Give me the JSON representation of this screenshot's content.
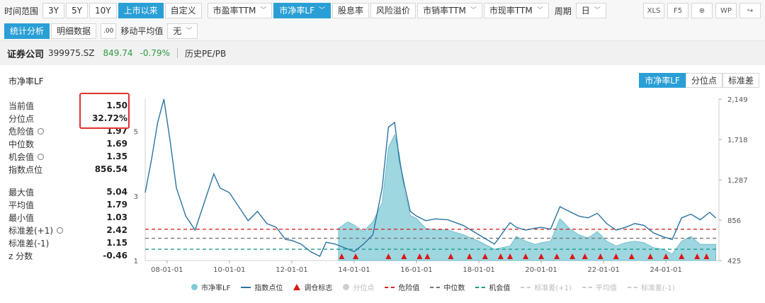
{
  "toolbar": {
    "range_label": "时间范围",
    "ranges": [
      {
        "label": "3Y",
        "active": false
      },
      {
        "label": "5Y",
        "active": false
      },
      {
        "label": "10Y",
        "active": false
      },
      {
        "label": "上市以来",
        "active": true
      },
      {
        "label": "自定义",
        "active": false
      }
    ],
    "metrics": [
      {
        "label": "市盈率TTM",
        "dropdown": true,
        "active": false
      },
      {
        "label": "市净率LF",
        "dropdown": true,
        "active": true
      },
      {
        "label": "股息率",
        "dropdown": false,
        "active": false
      },
      {
        "label": "风险溢价",
        "dropdown": false,
        "active": false
      },
      {
        "label": "市销率TTM",
        "dropdown": true,
        "active": false
      },
      {
        "label": "市现率TTM",
        "dropdown": true,
        "active": false
      }
    ],
    "period_label": "周期",
    "period_value": "日",
    "right_tools": [
      "XLS",
      "F5",
      "⊕",
      "WP",
      "↪"
    ],
    "view_tabs": [
      {
        "label": "统计分析",
        "active": true
      },
      {
        "label": "明细数据",
        "active": false
      }
    ],
    "decimal_icon": ".00",
    "ma_label": "移动平均值",
    "ma_value": "无"
  },
  "header": {
    "name": "证券公司",
    "code": "399975.SZ",
    "price": "849.74",
    "change": "-0.79%",
    "hist": "历史PE/PB"
  },
  "panel": {
    "title": "市净率LF",
    "tabs": [
      {
        "label": "市净率LF",
        "active": true
      },
      {
        "label": "分位点",
        "active": false
      },
      {
        "label": "标准差",
        "active": false
      }
    ]
  },
  "stats": {
    "group1": [
      {
        "name": "当前值",
        "value": "1.50",
        "gear": false
      },
      {
        "name": "分位点",
        "value": "32.72%",
        "gear": false
      },
      {
        "name": "危险值",
        "value": "1.97",
        "gear": true
      },
      {
        "name": "中位数",
        "value": "1.69",
        "gear": false
      },
      {
        "name": "机会值",
        "value": "1.35",
        "gear": true
      },
      {
        "name": "指数点位",
        "value": "856.54",
        "gear": false
      }
    ],
    "group2": [
      {
        "name": "最大值",
        "value": "5.04",
        "gear": false
      },
      {
        "name": "平均值",
        "value": "1.79",
        "gear": false
      },
      {
        "name": "最小值",
        "value": "1.03",
        "gear": false
      },
      {
        "name": "标准差(+1)",
        "value": "2.42",
        "gear": true
      },
      {
        "name": "标准差(-1)",
        "value": "1.15",
        "gear": false
      },
      {
        "name": "z 分数",
        "value": "-0.46",
        "gear": false
      }
    ]
  },
  "chart_data": {
    "type": "line",
    "x_ticks": [
      "08-01-01",
      "10-01-01",
      "12-01-01",
      "14-01-01",
      "16-01-01",
      "18-01-01",
      "20-01-01",
      "22-01-01",
      "24-01-01"
    ],
    "x_range": [
      2007.3,
      2025.7
    ],
    "y_left_ticks": [
      "5",
      "3",
      "1"
    ],
    "y_left_range": [
      1,
      6
    ],
    "y_right_ticks": [
      "2,149",
      "1,718",
      "1,287",
      "856",
      "425"
    ],
    "y_right_range": [
      425,
      2149
    ],
    "grid": false,
    "legend": [
      {
        "name": "市净率LF",
        "kind": "dot",
        "color": "#7ecad6",
        "muted": false
      },
      {
        "name": "指数点位",
        "kind": "line",
        "color": "#2b73a0",
        "muted": false
      },
      {
        "name": "调仓标志",
        "kind": "tri",
        "color": "#e01414",
        "muted": false
      },
      {
        "name": "分位点",
        "kind": "dot",
        "color": "#cfcfcf",
        "muted": true
      },
      {
        "name": "危险值",
        "kind": "dash",
        "color": "#d42a2a",
        "muted": false
      },
      {
        "name": "中位数",
        "kind": "dash",
        "color": "#777777",
        "muted": false
      },
      {
        "name": "机会值",
        "kind": "dash",
        "color": "#1e9c8a",
        "muted": false
      },
      {
        "name": "标准差(+1)",
        "kind": "dash",
        "color": "#cccccc",
        "muted": true
      },
      {
        "name": "平均值",
        "kind": "dash",
        "color": "#cccccc",
        "muted": true
      },
      {
        "name": "标准差(-1)",
        "kind": "dash",
        "color": "#cccccc",
        "muted": true
      }
    ],
    "levels": {
      "danger": 1.97,
      "median": 1.69,
      "opportunity": 1.35
    },
    "pb_series": {
      "x": [
        2013.5,
        2013.8,
        2014.0,
        2014.3,
        2014.6,
        2014.9,
        2015.1,
        2015.3,
        2015.45,
        2015.6,
        2015.8,
        2016.0,
        2016.3,
        2016.6,
        2017.0,
        2017.5,
        2018.0,
        2018.5,
        2019.0,
        2019.2,
        2019.5,
        2019.8,
        2020.0,
        2020.3,
        2020.6,
        2020.9,
        2021.2,
        2021.5,
        2021.8,
        2022.1,
        2022.4,
        2022.7,
        2023.0,
        2023.3,
        2023.6,
        2023.9,
        2024.2,
        2024.5,
        2024.8,
        2025.1,
        2025.4,
        2025.6
      ],
      "y": [
        2.0,
        2.2,
        2.1,
        1.9,
        2.2,
        2.8,
        4.5,
        4.9,
        4.3,
        3.2,
        2.4,
        2.3,
        2.0,
        1.95,
        1.95,
        1.8,
        1.6,
        1.35,
        1.45,
        1.75,
        1.6,
        1.5,
        1.55,
        1.6,
        2.3,
        2.0,
        1.8,
        1.7,
        1.9,
        1.6,
        1.45,
        1.55,
        1.6,
        1.55,
        1.4,
        1.35,
        1.2,
        1.6,
        1.75,
        1.5,
        1.5,
        1.5
      ]
    },
    "index_series": {
      "x": [
        2007.3,
        2007.5,
        2007.7,
        2007.9,
        2008.1,
        2008.3,
        2008.6,
        2008.9,
        2009.2,
        2009.5,
        2009.7,
        2010.0,
        2010.3,
        2010.6,
        2010.9,
        2011.2,
        2011.5,
        2011.8,
        2012.0,
        2012.3,
        2012.6,
        2012.9,
        2013.1,
        2013.4,
        2013.7,
        2014.0,
        2014.3,
        2014.6,
        2014.9,
        2015.1,
        2015.3,
        2015.45,
        2015.6,
        2015.8,
        2016.0,
        2016.3,
        2016.6,
        2017.0,
        2017.5,
        2018.0,
        2018.5,
        2019.0,
        2019.2,
        2019.5,
        2019.8,
        2020.0,
        2020.3,
        2020.6,
        2020.9,
        2021.2,
        2021.5,
        2021.8,
        2022.1,
        2022.4,
        2022.7,
        2023.0,
        2023.3,
        2023.6,
        2023.9,
        2024.2,
        2024.5,
        2024.8,
        2025.1,
        2025.4,
        2025.6
      ],
      "y": [
        1150,
        1500,
        1900,
        2149,
        1700,
        1200,
        900,
        750,
        1050,
        1350,
        1200,
        1150,
        1000,
        850,
        950,
        820,
        780,
        650,
        640,
        600,
        520,
        470,
        620,
        600,
        560,
        520,
        600,
        700,
        1200,
        1850,
        1900,
        1500,
        1250,
        950,
        900,
        850,
        870,
        860,
        800,
        700,
        600,
        830,
        780,
        750,
        770,
        780,
        760,
        1000,
        950,
        900,
        880,
        930,
        820,
        750,
        780,
        820,
        800,
        720,
        680,
        650,
        880,
        920,
        860,
        940,
        880
      ]
    },
    "rebalance_flags_x": [
      2013.6,
      2014.05,
      2015.1,
      2015.6,
      2016.1,
      2016.35,
      2017.1,
      2017.7,
      2018.2,
      2018.7,
      2019.0,
      2019.5,
      2020.0,
      2020.5,
      2021.0,
      2021.4,
      2021.9,
      2022.4,
      2022.9,
      2023.5,
      2024.0,
      2024.5,
      2025.0,
      2025.3
    ]
  }
}
